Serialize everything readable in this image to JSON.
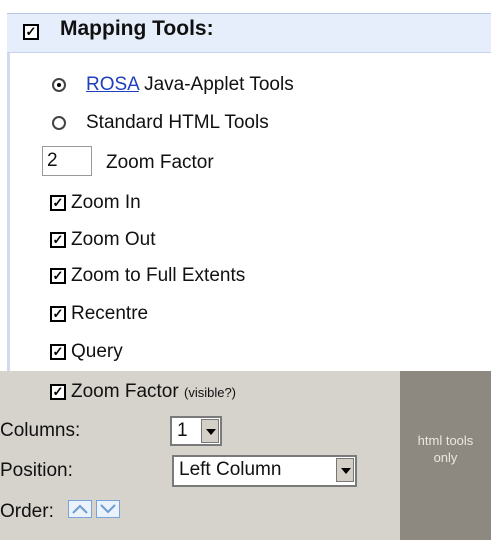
{
  "header": {
    "title": "Mapping Tools:",
    "checked": true
  },
  "radios": [
    {
      "link": "ROSA",
      "rest": " Java-Applet Tools",
      "selected": true
    },
    {
      "label": "Standard HTML Tools",
      "selected": false
    }
  ],
  "zoom_factor": {
    "value": "2",
    "label": "Zoom Factor"
  },
  "checkboxes": [
    {
      "label": "Zoom In",
      "checked": true
    },
    {
      "label": "Zoom Out",
      "checked": true
    },
    {
      "label": "Zoom to Full Extents",
      "checked": true
    },
    {
      "label": "Recentre",
      "checked": true
    },
    {
      "label": "Query",
      "checked": true
    }
  ],
  "panel": {
    "zoom_visible": {
      "label": "Zoom Factor",
      "hint": "(visible?)",
      "checked": true
    },
    "columns": {
      "label": "Columns:",
      "value": "1"
    },
    "position": {
      "label": "Position:",
      "value": "Left Column"
    },
    "order": {
      "label": "Order:"
    },
    "note": {
      "line1": "html tools",
      "line2": "only"
    }
  },
  "colors": {
    "header_bg": "#e6eefb",
    "panel_bg": "#d6d2cc",
    "dark_bg": "#8e8980",
    "link": "#1f3fbf"
  },
  "icons": [
    "checkbox-checked-icon",
    "radio-selected-icon",
    "radio-unselected-icon",
    "dropdown-arrow-icon",
    "move-up-icon",
    "move-down-icon"
  ]
}
